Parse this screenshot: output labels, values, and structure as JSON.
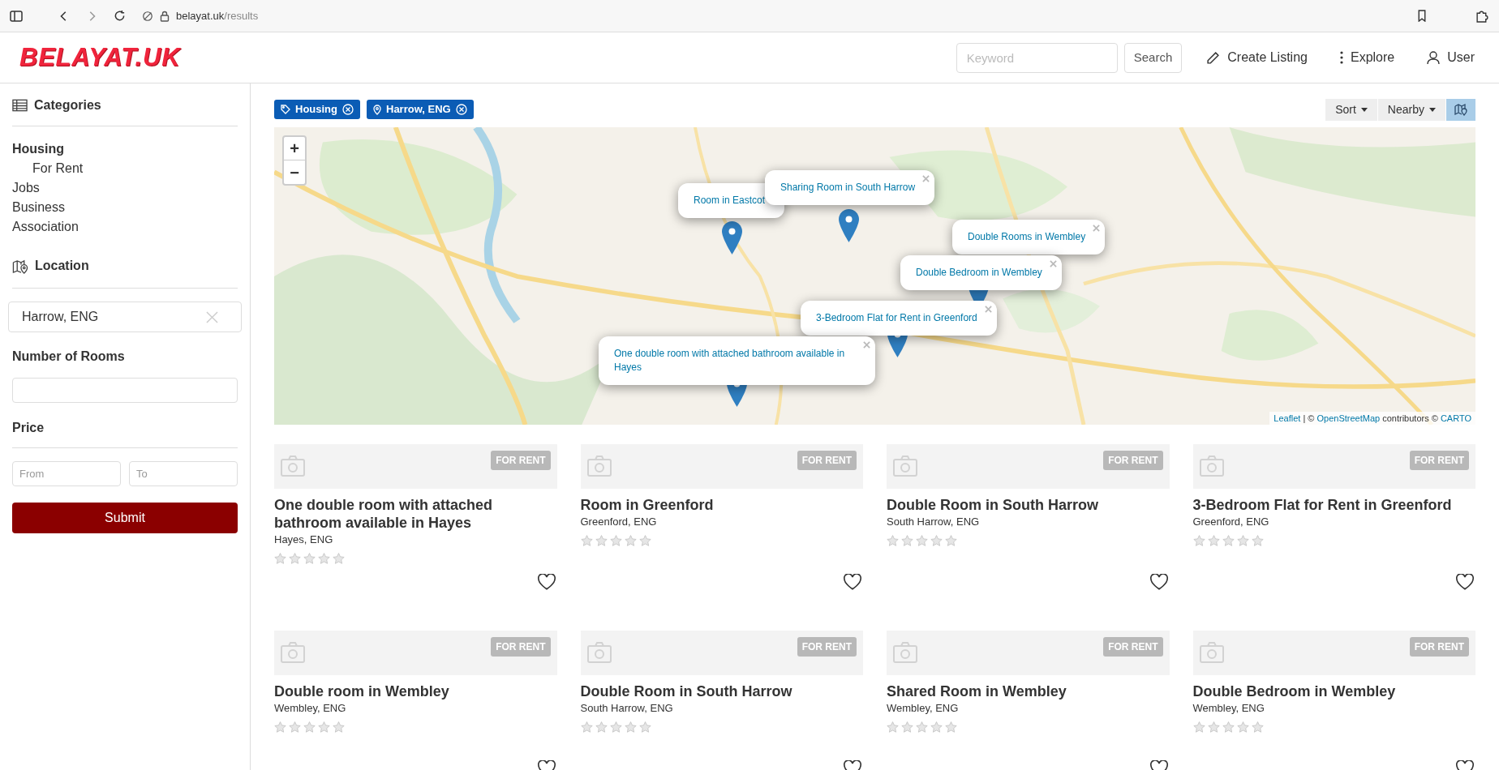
{
  "browser": {
    "url_host": "belayat.uk",
    "url_path": "/results"
  },
  "header": {
    "logo": "BELAYAT.UK",
    "search_placeholder": "Keyword",
    "search_button": "Search",
    "nav": [
      {
        "kind": "pencil",
        "label": "Create Listing"
      },
      {
        "kind": "dots",
        "label": "Explore"
      },
      {
        "kind": "user",
        "label": "User"
      }
    ]
  },
  "sidebar": {
    "categories_title": "Categories",
    "categories": [
      {
        "label": "Housing",
        "selected": true,
        "children": [
          {
            "label": "For Rent",
            "selected": false
          }
        ]
      },
      {
        "label": "Jobs",
        "selected": false
      },
      {
        "label": "Business",
        "selected": false
      },
      {
        "label": "Association",
        "selected": false
      }
    ],
    "location_title": "Location",
    "location_value": "Harrow, ENG",
    "rooms_title": "Number of Rooms",
    "price_title": "Price",
    "price_from_placeholder": "From",
    "price_to_placeholder": "To",
    "submit": "Submit"
  },
  "filters": [
    {
      "kind": "tag",
      "label": "Housing"
    },
    {
      "kind": "pin",
      "label": "Harrow, ENG"
    }
  ],
  "toolbar": {
    "sort": "Sort",
    "nearby": "Nearby",
    "map_toggle_selected": true
  },
  "map": {
    "zoom_in": "+",
    "zoom_out": "−",
    "popups": [
      {
        "text": "Room in Eastcot"
      },
      {
        "text": "Sharing Room in South Harrow"
      },
      {
        "text": "Double Rooms in Wembley"
      },
      {
        "text": "Double Bedroom in Wembley"
      },
      {
        "text": "3-Bedroom Flat for Rent in Greenford"
      },
      {
        "text": "One double room with attached bathroom available in Hayes"
      }
    ],
    "attribution": [
      {
        "kind": "link",
        "text": "Leaflet"
      },
      {
        "kind": "text",
        "text": " | © "
      },
      {
        "kind": "link",
        "text": "OpenStreetMap"
      },
      {
        "kind": "text",
        "text": " contributors © "
      },
      {
        "kind": "link",
        "text": "CARTO"
      }
    ]
  },
  "listings": [
    {
      "badge": "FOR RENT",
      "title": "One double room with attached bathroom available in Hayes",
      "location": "Hayes, ENG",
      "stars": 0
    },
    {
      "badge": "FOR RENT",
      "title": "Room in Greenford",
      "location": "Greenford, ENG",
      "stars": 0
    },
    {
      "badge": "FOR RENT",
      "title": "Double Room in South Harrow",
      "location": "South Harrow, ENG",
      "stars": 0
    },
    {
      "badge": "FOR RENT",
      "title": "3-Bedroom Flat for Rent in Greenford",
      "location": "Greenford, ENG",
      "stars": 0
    },
    {
      "badge": "FOR RENT",
      "title": "Double room in Wembley",
      "location": "Wembley, ENG",
      "stars": 0
    },
    {
      "badge": "FOR RENT",
      "title": "Double Room in South Harrow",
      "location": "South Harrow, ENG",
      "stars": 0
    },
    {
      "badge": "FOR RENT",
      "title": "Shared Room in Wembley",
      "location": "Wembley, ENG",
      "stars": 0
    },
    {
      "badge": "FOR RENT",
      "title": "Double Bedroom in Wembley",
      "location": "Wembley, ENG",
      "stars": 0
    }
  ]
}
